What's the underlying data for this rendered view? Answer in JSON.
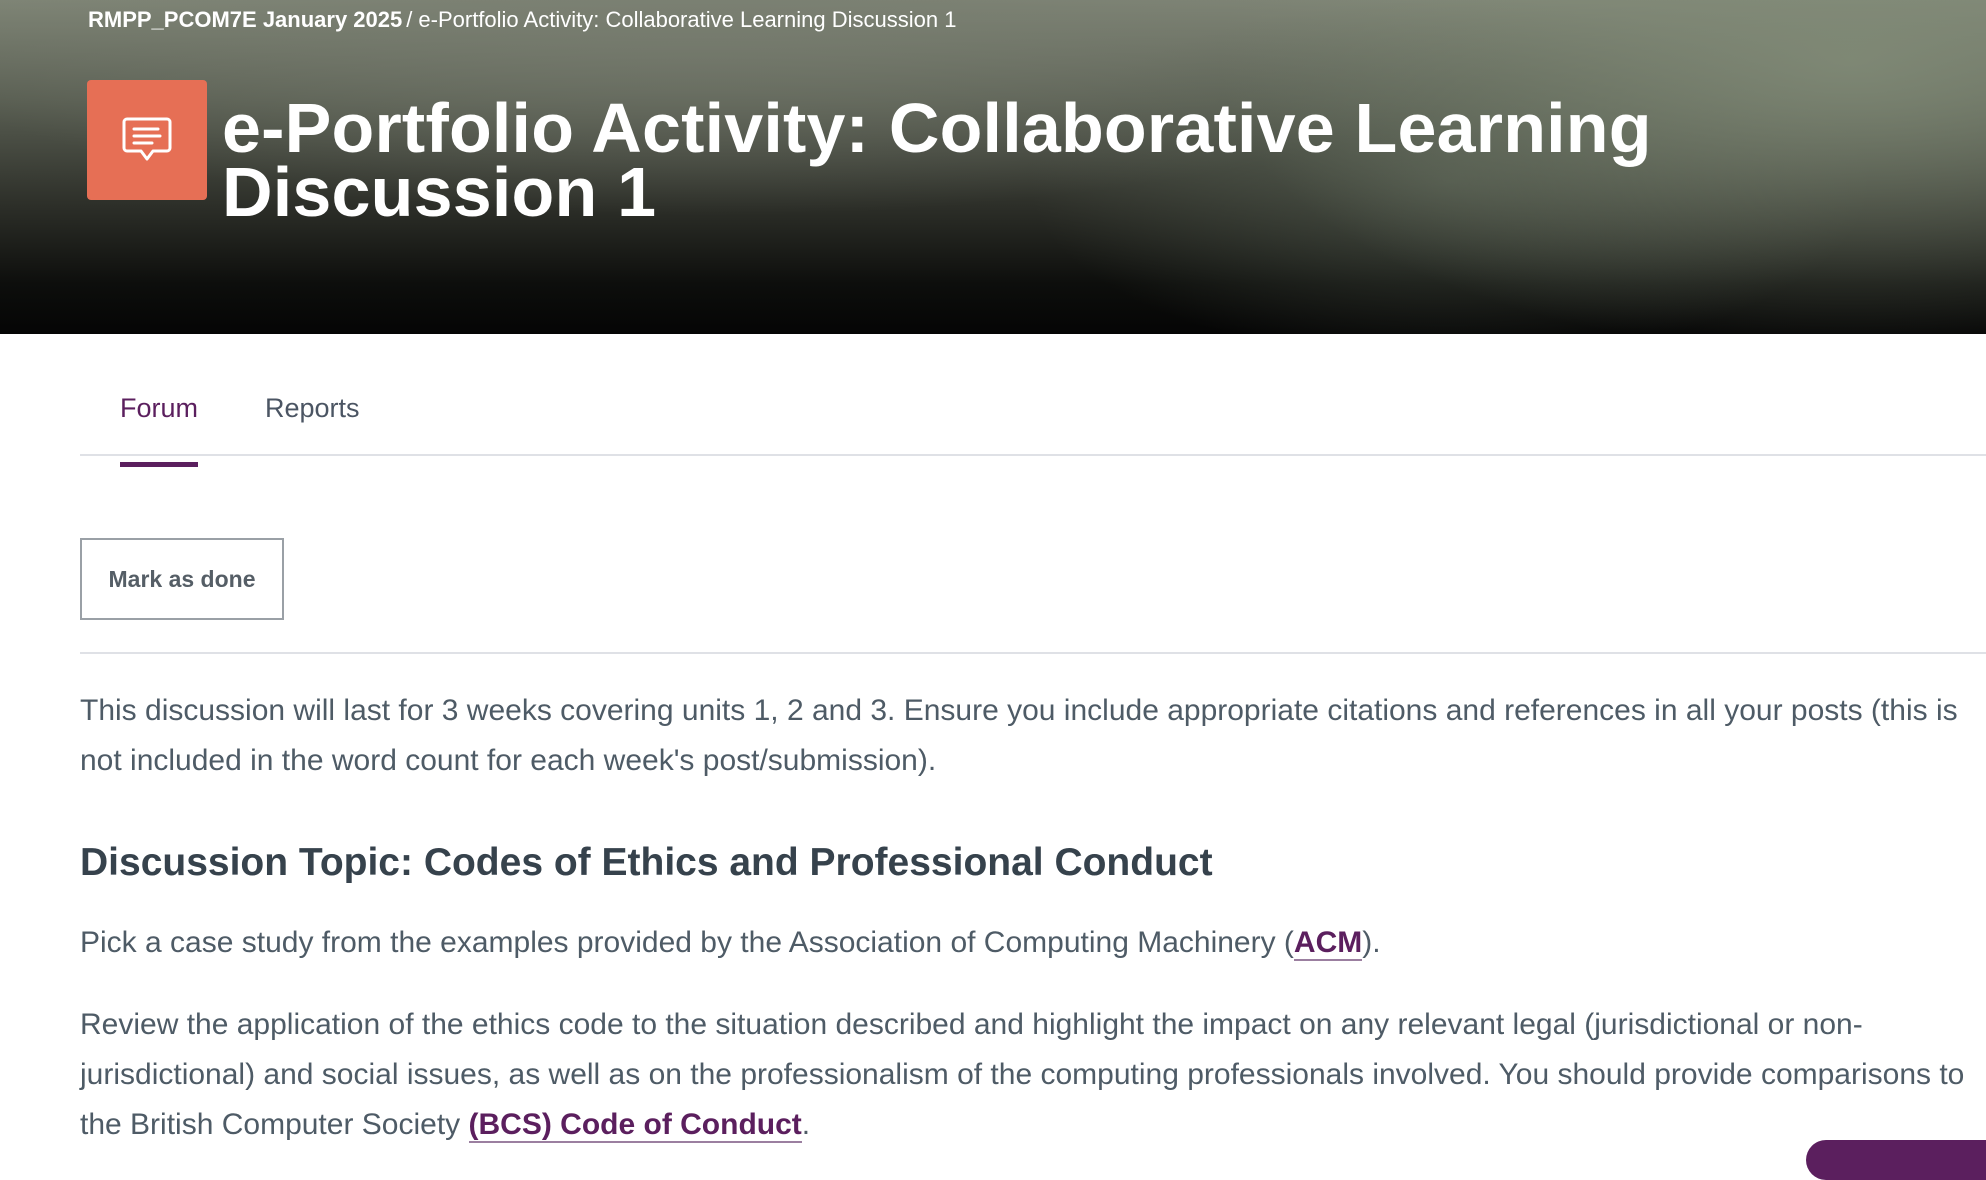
{
  "breadcrumb": {
    "course": "RMPP_PCOM7E January 2025",
    "separator": "/",
    "current": "e-Portfolio Activity: Collaborative Learning Discussion 1"
  },
  "header": {
    "icon": "forum-chat-icon",
    "icon_color": "#e66f55",
    "title": "e-Portfolio Activity: Collaborative Learning Discussion 1"
  },
  "tabs": [
    {
      "label": "Forum",
      "active": true
    },
    {
      "label": "Reports",
      "active": false
    }
  ],
  "completion": {
    "button_label": "Mark as done"
  },
  "content": {
    "intro": "This discussion will last for 3 weeks covering units 1, 2 and 3. Ensure you include appropriate citations and references in all your posts (this is not included in the word count for each week's post/submission).",
    "topic_heading": "Discussion Topic: Codes of Ethics and Professional Conduct",
    "acm_para": {
      "before": "Pick a case study from the examples provided by the Association of Computing Machinery (",
      "link": "ACM",
      "after": ")."
    },
    "review_para": {
      "before": "Review the application of the ethics code to the situation described and highlight the impact on any relevant legal (jurisdictional or non-jurisdictional) and social issues, as well as on the professionalism of the computing professionals involved. You should provide comparisons to the British Computer Society ",
      "link": "(BCS) Code of Conduct",
      "after": "."
    }
  },
  "colors": {
    "accent": "#5b1f5e",
    "body_text": "#4e5b66",
    "heading_text": "#36424c"
  }
}
